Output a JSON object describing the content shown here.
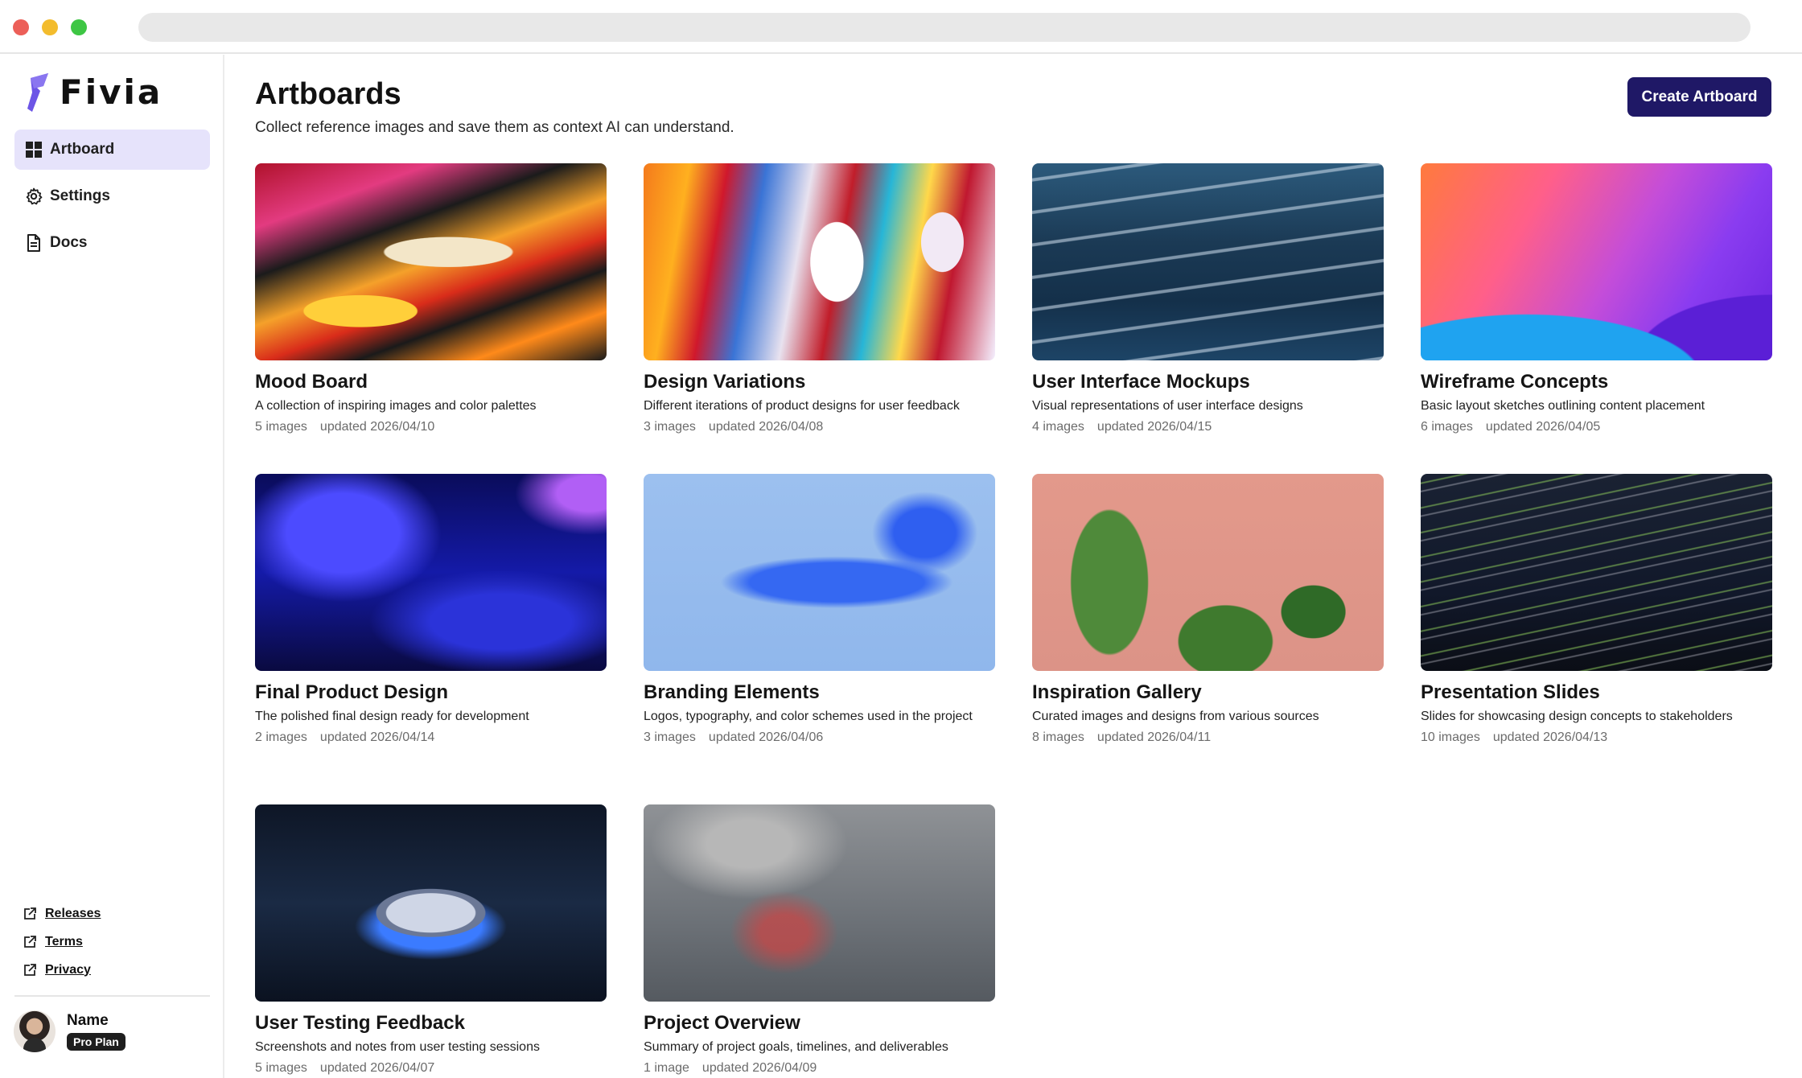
{
  "app": {
    "name": "Fivia"
  },
  "sidebar": {
    "nav": [
      {
        "label": "Artboard",
        "icon": "grid-icon",
        "active": true
      },
      {
        "label": "Settings",
        "icon": "gear-icon",
        "active": false
      },
      {
        "label": "Docs",
        "icon": "document-icon",
        "active": false
      }
    ],
    "links": [
      {
        "label": "Releases",
        "icon": "external-link-icon"
      },
      {
        "label": "Terms",
        "icon": "external-link-icon"
      },
      {
        "label": "Privacy",
        "icon": "external-link-icon"
      }
    ],
    "user": {
      "name": "Name",
      "plan": "Pro Plan"
    }
  },
  "header": {
    "title": "Artboards",
    "subtitle": "Collect reference images and save them as context AI can understand.",
    "create_label": "Create Artboard"
  },
  "artboards": [
    {
      "title": "Mood Board",
      "description": "A collection of inspiring images and color palettes",
      "images": "5 images",
      "updated": "updated 2026/04/10"
    },
    {
      "title": "Design Variations",
      "description": "Different iterations of product designs for user feedback",
      "images": "3 images",
      "updated": "updated 2026/04/08"
    },
    {
      "title": "User Interface Mockups",
      "description": "Visual representations of user interface designs",
      "images": "4 images",
      "updated": "updated 2026/04/15"
    },
    {
      "title": "Wireframe Concepts",
      "description": "Basic layout sketches outlining content placement",
      "images": "6 images",
      "updated": "updated 2026/04/05"
    },
    {
      "title": "Final Product Design",
      "description": "The polished final design ready for development",
      "images": "2 images",
      "updated": "updated 2026/04/14"
    },
    {
      "title": "Branding Elements",
      "description": "Logos, typography, and color schemes used in the project",
      "images": "3 images",
      "updated": "updated 2026/04/06"
    },
    {
      "title": "Inspiration Gallery",
      "description": "Curated images and designs from various sources",
      "images": "8 images",
      "updated": "updated 2026/04/11"
    },
    {
      "title": "Presentation Slides",
      "description": "Slides for showcasing design concepts to stakeholders",
      "images": "10 images",
      "updated": "updated 2026/04/13"
    },
    {
      "title": "User Testing Feedback",
      "description": "Screenshots and notes from user testing sessions",
      "images": "5 images",
      "updated": "updated 2026/04/07"
    },
    {
      "title": "Project Overview",
      "description": "Summary of project goals, timelines, and deliverables",
      "images": "1 image",
      "updated": "updated 2026/04/09"
    }
  ],
  "colors": {
    "accent": "#1f1866",
    "nav_active_bg": "#e6e3fb",
    "logo": "#6c55e6"
  }
}
